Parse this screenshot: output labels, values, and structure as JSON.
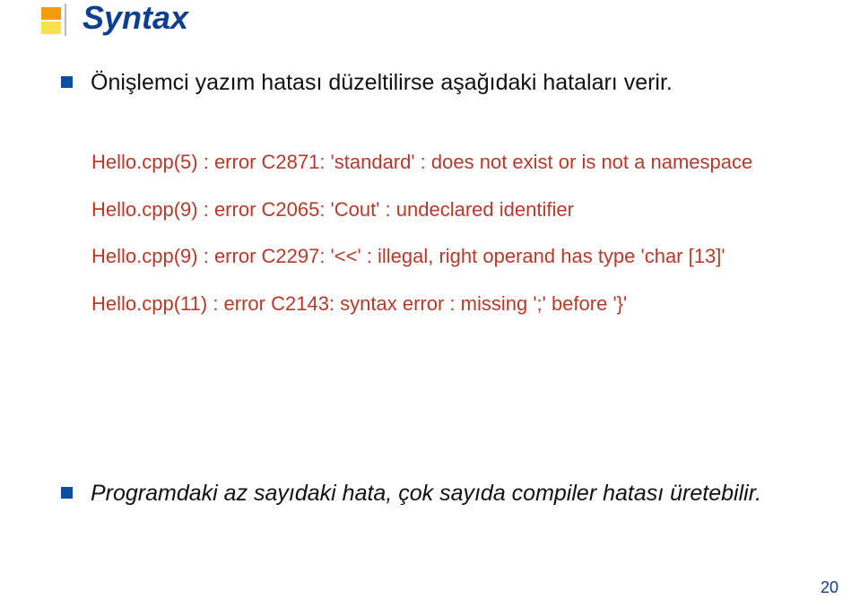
{
  "title": "Syntax",
  "intro": "Önişlemci yazım hatası düzeltilirse aşağıdaki hataları verir.",
  "errors": {
    "line1": "Hello.cpp(5) : error C2871: 'standard' : does not exist or is not a namespace",
    "line2": "Hello.cpp(9) : error C2065: 'Cout' : undeclared identifier",
    "line3": "Hello.cpp(9) : error C2297: '<<' : illegal, right operand has type 'char [13]'",
    "line4": "Hello.cpp(11) : error C2143: syntax error : missing ';' before '}'"
  },
  "footnote": "Programdaki az sayıdaki hata, çok sayıda compiler hatası üretebilir.",
  "page": "20"
}
